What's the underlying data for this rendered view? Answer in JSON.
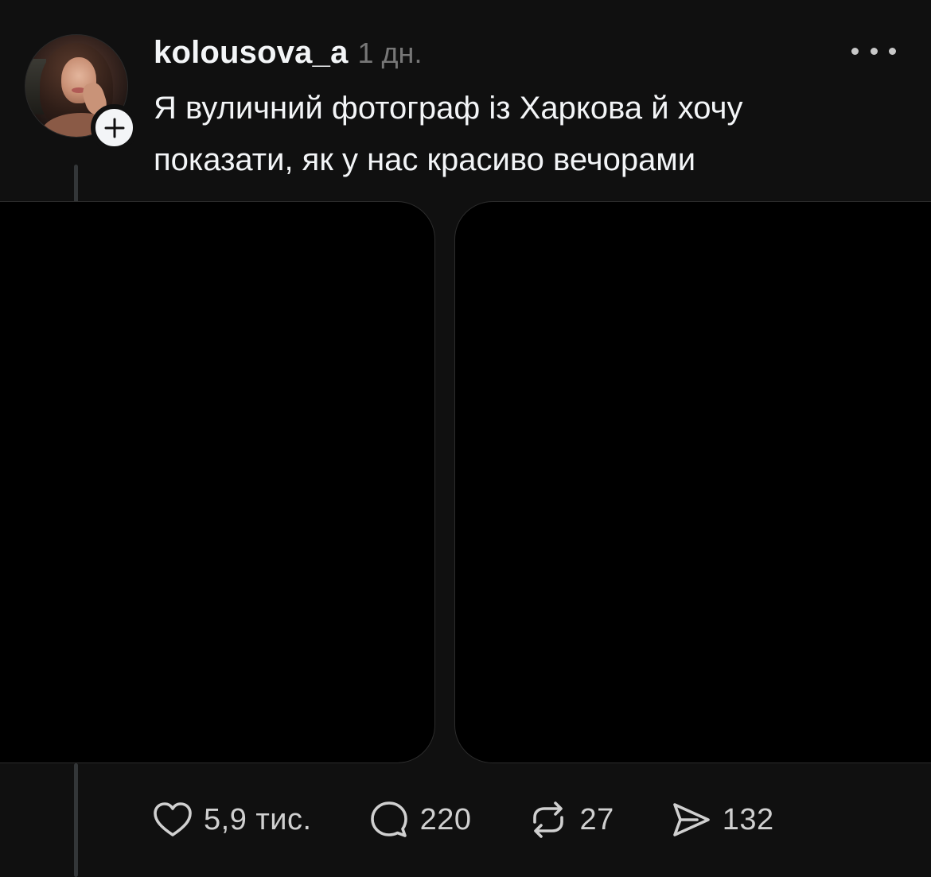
{
  "post": {
    "author": {
      "username": "kolousova_a",
      "time": "1 дн."
    },
    "caption": "Я вуличний фотограф із Харкова й хочу показати, як у нас красиво вечорами",
    "media_count": 2,
    "actions": {
      "likes": "5,9 тис.",
      "comments": "220",
      "reposts": "27",
      "shares": "132"
    }
  },
  "icons": {
    "follow": "plus-icon",
    "more": "more-horizontal-icon",
    "like": "heart-icon",
    "comment": "comment-bubble-icon",
    "repost": "repost-icon",
    "share": "send-icon"
  },
  "colors": {
    "background": "#101010",
    "text": "#f3f5f7",
    "muted": "#777777",
    "media": "#000000"
  }
}
